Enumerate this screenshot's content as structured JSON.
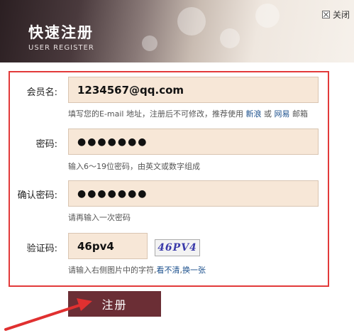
{
  "header": {
    "title": "快速注册",
    "subtitle": "USER REGISTER",
    "close_label": "关闭"
  },
  "form": {
    "member": {
      "label": "会员名:",
      "value": "1234567@qq.com",
      "hint_prefix": "填写您的E-mail 地址，注册后不可修改，推荐使用",
      "link1": "新浪",
      "sep": "或",
      "link2": "网易",
      "hint_suffix": "邮箱"
    },
    "password": {
      "label": "密码:",
      "value": "●●●●●●●",
      "hint": "输入6～19位密码，由英文或数字组成"
    },
    "confirm": {
      "label": "确认密码:",
      "value": "●●●●●●●",
      "hint": "请再输入一次密码"
    },
    "captcha": {
      "label": "验证码:",
      "value": "46pv4",
      "image_text": "46PV4",
      "hint_prefix": "请输入右侧图片中的字符,",
      "link1": "看不清",
      "sep": ",",
      "link2": "换一张"
    }
  },
  "submit_label": "注册",
  "colors": {
    "border": "#e23a3a",
    "input_bg": "#f7e7d7",
    "button_bg": "#6b2e35",
    "link": "#1a4f8c",
    "arrow": "#e03030"
  }
}
